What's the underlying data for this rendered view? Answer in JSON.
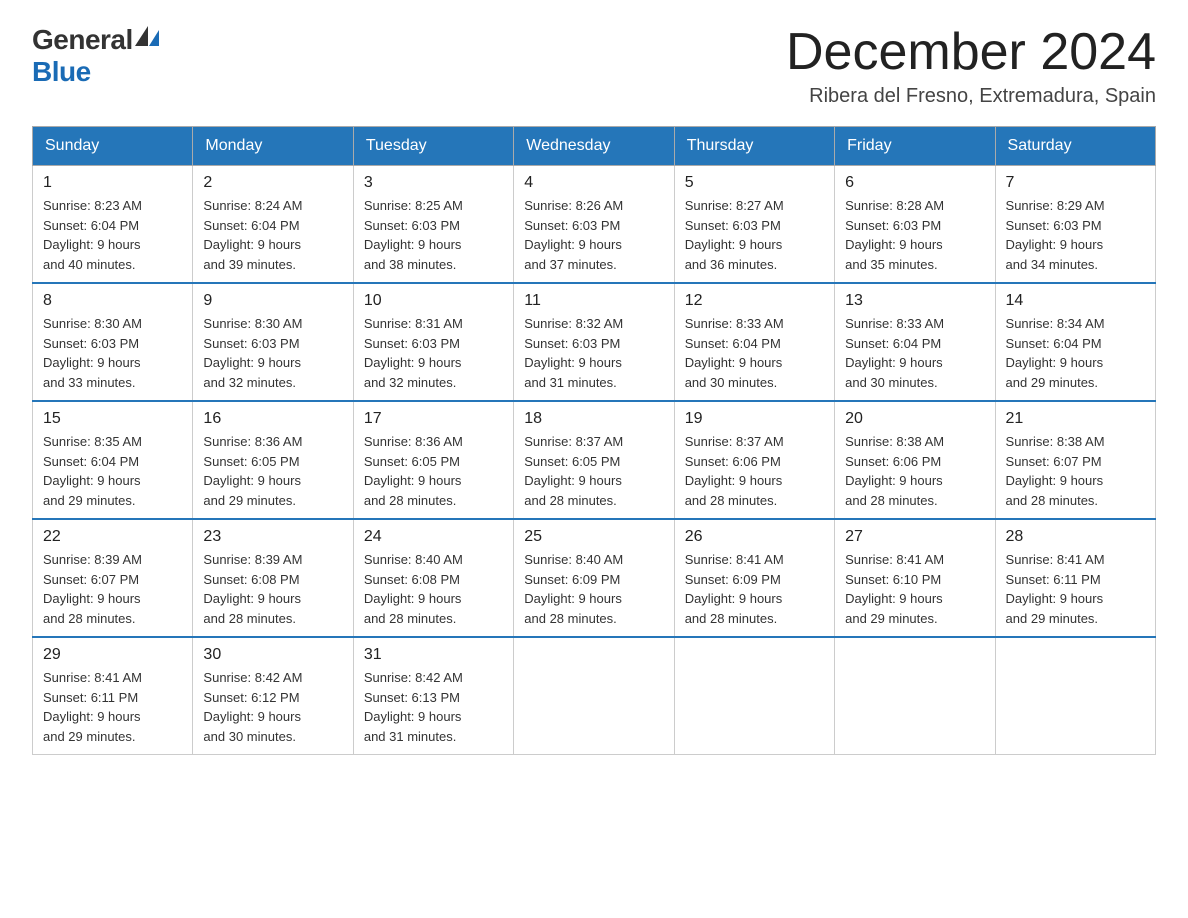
{
  "logo": {
    "general": "General",
    "blue": "Blue"
  },
  "header": {
    "month_title": "December 2024",
    "subtitle": "Ribera del Fresno, Extremadura, Spain"
  },
  "days_of_week": [
    "Sunday",
    "Monday",
    "Tuesday",
    "Wednesday",
    "Thursday",
    "Friday",
    "Saturday"
  ],
  "weeks": [
    [
      {
        "day": "1",
        "sunrise": "8:23 AM",
        "sunset": "6:04 PM",
        "daylight": "9 hours and 40 minutes."
      },
      {
        "day": "2",
        "sunrise": "8:24 AM",
        "sunset": "6:04 PM",
        "daylight": "9 hours and 39 minutes."
      },
      {
        "day": "3",
        "sunrise": "8:25 AM",
        "sunset": "6:03 PM",
        "daylight": "9 hours and 38 minutes."
      },
      {
        "day": "4",
        "sunrise": "8:26 AM",
        "sunset": "6:03 PM",
        "daylight": "9 hours and 37 minutes."
      },
      {
        "day": "5",
        "sunrise": "8:27 AM",
        "sunset": "6:03 PM",
        "daylight": "9 hours and 36 minutes."
      },
      {
        "day": "6",
        "sunrise": "8:28 AM",
        "sunset": "6:03 PM",
        "daylight": "9 hours and 35 minutes."
      },
      {
        "day": "7",
        "sunrise": "8:29 AM",
        "sunset": "6:03 PM",
        "daylight": "9 hours and 34 minutes."
      }
    ],
    [
      {
        "day": "8",
        "sunrise": "8:30 AM",
        "sunset": "6:03 PM",
        "daylight": "9 hours and 33 minutes."
      },
      {
        "day": "9",
        "sunrise": "8:30 AM",
        "sunset": "6:03 PM",
        "daylight": "9 hours and 32 minutes."
      },
      {
        "day": "10",
        "sunrise": "8:31 AM",
        "sunset": "6:03 PM",
        "daylight": "9 hours and 32 minutes."
      },
      {
        "day": "11",
        "sunrise": "8:32 AM",
        "sunset": "6:03 PM",
        "daylight": "9 hours and 31 minutes."
      },
      {
        "day": "12",
        "sunrise": "8:33 AM",
        "sunset": "6:04 PM",
        "daylight": "9 hours and 30 minutes."
      },
      {
        "day": "13",
        "sunrise": "8:33 AM",
        "sunset": "6:04 PM",
        "daylight": "9 hours and 30 minutes."
      },
      {
        "day": "14",
        "sunrise": "8:34 AM",
        "sunset": "6:04 PM",
        "daylight": "9 hours and 29 minutes."
      }
    ],
    [
      {
        "day": "15",
        "sunrise": "8:35 AM",
        "sunset": "6:04 PM",
        "daylight": "9 hours and 29 minutes."
      },
      {
        "day": "16",
        "sunrise": "8:36 AM",
        "sunset": "6:05 PM",
        "daylight": "9 hours and 29 minutes."
      },
      {
        "day": "17",
        "sunrise": "8:36 AM",
        "sunset": "6:05 PM",
        "daylight": "9 hours and 28 minutes."
      },
      {
        "day": "18",
        "sunrise": "8:37 AM",
        "sunset": "6:05 PM",
        "daylight": "9 hours and 28 minutes."
      },
      {
        "day": "19",
        "sunrise": "8:37 AM",
        "sunset": "6:06 PM",
        "daylight": "9 hours and 28 minutes."
      },
      {
        "day": "20",
        "sunrise": "8:38 AM",
        "sunset": "6:06 PM",
        "daylight": "9 hours and 28 minutes."
      },
      {
        "day": "21",
        "sunrise": "8:38 AM",
        "sunset": "6:07 PM",
        "daylight": "9 hours and 28 minutes."
      }
    ],
    [
      {
        "day": "22",
        "sunrise": "8:39 AM",
        "sunset": "6:07 PM",
        "daylight": "9 hours and 28 minutes."
      },
      {
        "day": "23",
        "sunrise": "8:39 AM",
        "sunset": "6:08 PM",
        "daylight": "9 hours and 28 minutes."
      },
      {
        "day": "24",
        "sunrise": "8:40 AM",
        "sunset": "6:08 PM",
        "daylight": "9 hours and 28 minutes."
      },
      {
        "day": "25",
        "sunrise": "8:40 AM",
        "sunset": "6:09 PM",
        "daylight": "9 hours and 28 minutes."
      },
      {
        "day": "26",
        "sunrise": "8:41 AM",
        "sunset": "6:09 PM",
        "daylight": "9 hours and 28 minutes."
      },
      {
        "day": "27",
        "sunrise": "8:41 AM",
        "sunset": "6:10 PM",
        "daylight": "9 hours and 29 minutes."
      },
      {
        "day": "28",
        "sunrise": "8:41 AM",
        "sunset": "6:11 PM",
        "daylight": "9 hours and 29 minutes."
      }
    ],
    [
      {
        "day": "29",
        "sunrise": "8:41 AM",
        "sunset": "6:11 PM",
        "daylight": "9 hours and 29 minutes."
      },
      {
        "day": "30",
        "sunrise": "8:42 AM",
        "sunset": "6:12 PM",
        "daylight": "9 hours and 30 minutes."
      },
      {
        "day": "31",
        "sunrise": "8:42 AM",
        "sunset": "6:13 PM",
        "daylight": "9 hours and 31 minutes."
      },
      null,
      null,
      null,
      null
    ]
  ],
  "labels": {
    "sunrise": "Sunrise:",
    "sunset": "Sunset:",
    "daylight": "Daylight:"
  }
}
